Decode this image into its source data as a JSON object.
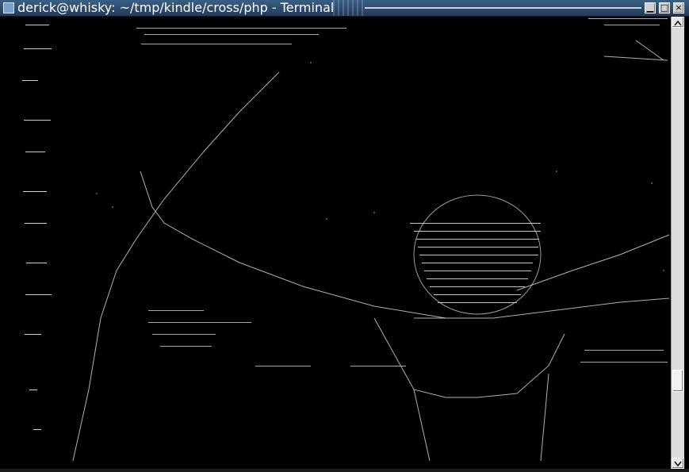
{
  "window": {
    "title": "derick@whisky: ~/tmp/kindle/cross/php - Terminal"
  },
  "titlebar": {
    "buttons": [
      {
        "name": "minimize",
        "glyph": "▁"
      },
      {
        "name": "maximize",
        "glyph": "□"
      },
      {
        "name": "close",
        "glyph": "×"
      }
    ]
  }
}
